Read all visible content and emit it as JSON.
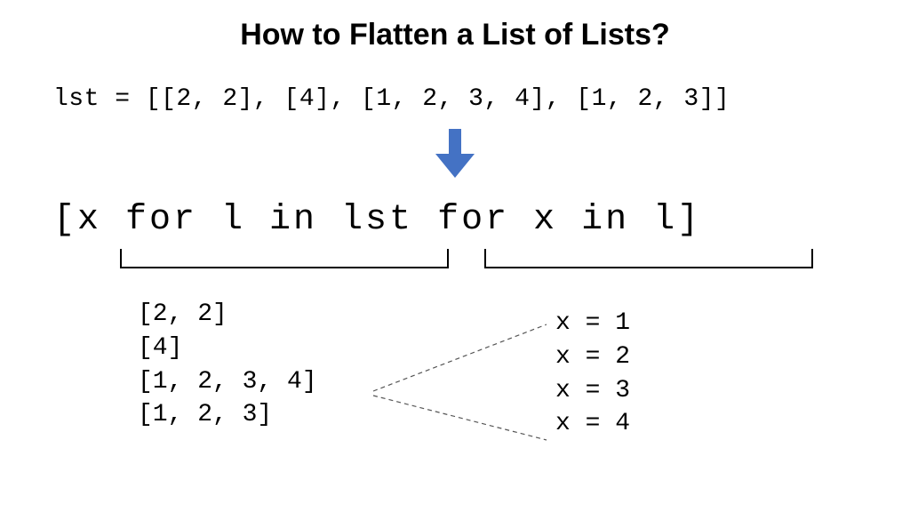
{
  "title": "How to Flatten a List of Lists?",
  "lst_def": "lst = [[2, 2], [4], [1, 2, 3, 4], [1, 2, 3]]",
  "comprehension": "[x for l in lst for x in l]",
  "left_lines": "[2, 2]\n[4]\n[1, 2, 3, 4]\n[1, 2, 3]",
  "right_lines": "x = 1\nx = 2\nx = 3\nx = 4",
  "colors": {
    "arrow": "#4472C4"
  },
  "chart_data": {
    "type": "table",
    "input": [
      [
        2,
        2
      ],
      [
        4
      ],
      [
        1,
        2,
        3,
        4
      ],
      [
        1,
        2,
        3
      ]
    ],
    "expression": "[x for l in lst for x in l]",
    "outer_loop_values": [
      "[2, 2]",
      "[4]",
      "[1, 2, 3, 4]",
      "[1, 2, 3]"
    ],
    "inner_loop_sample_values": [
      1,
      2,
      3,
      4
    ]
  }
}
